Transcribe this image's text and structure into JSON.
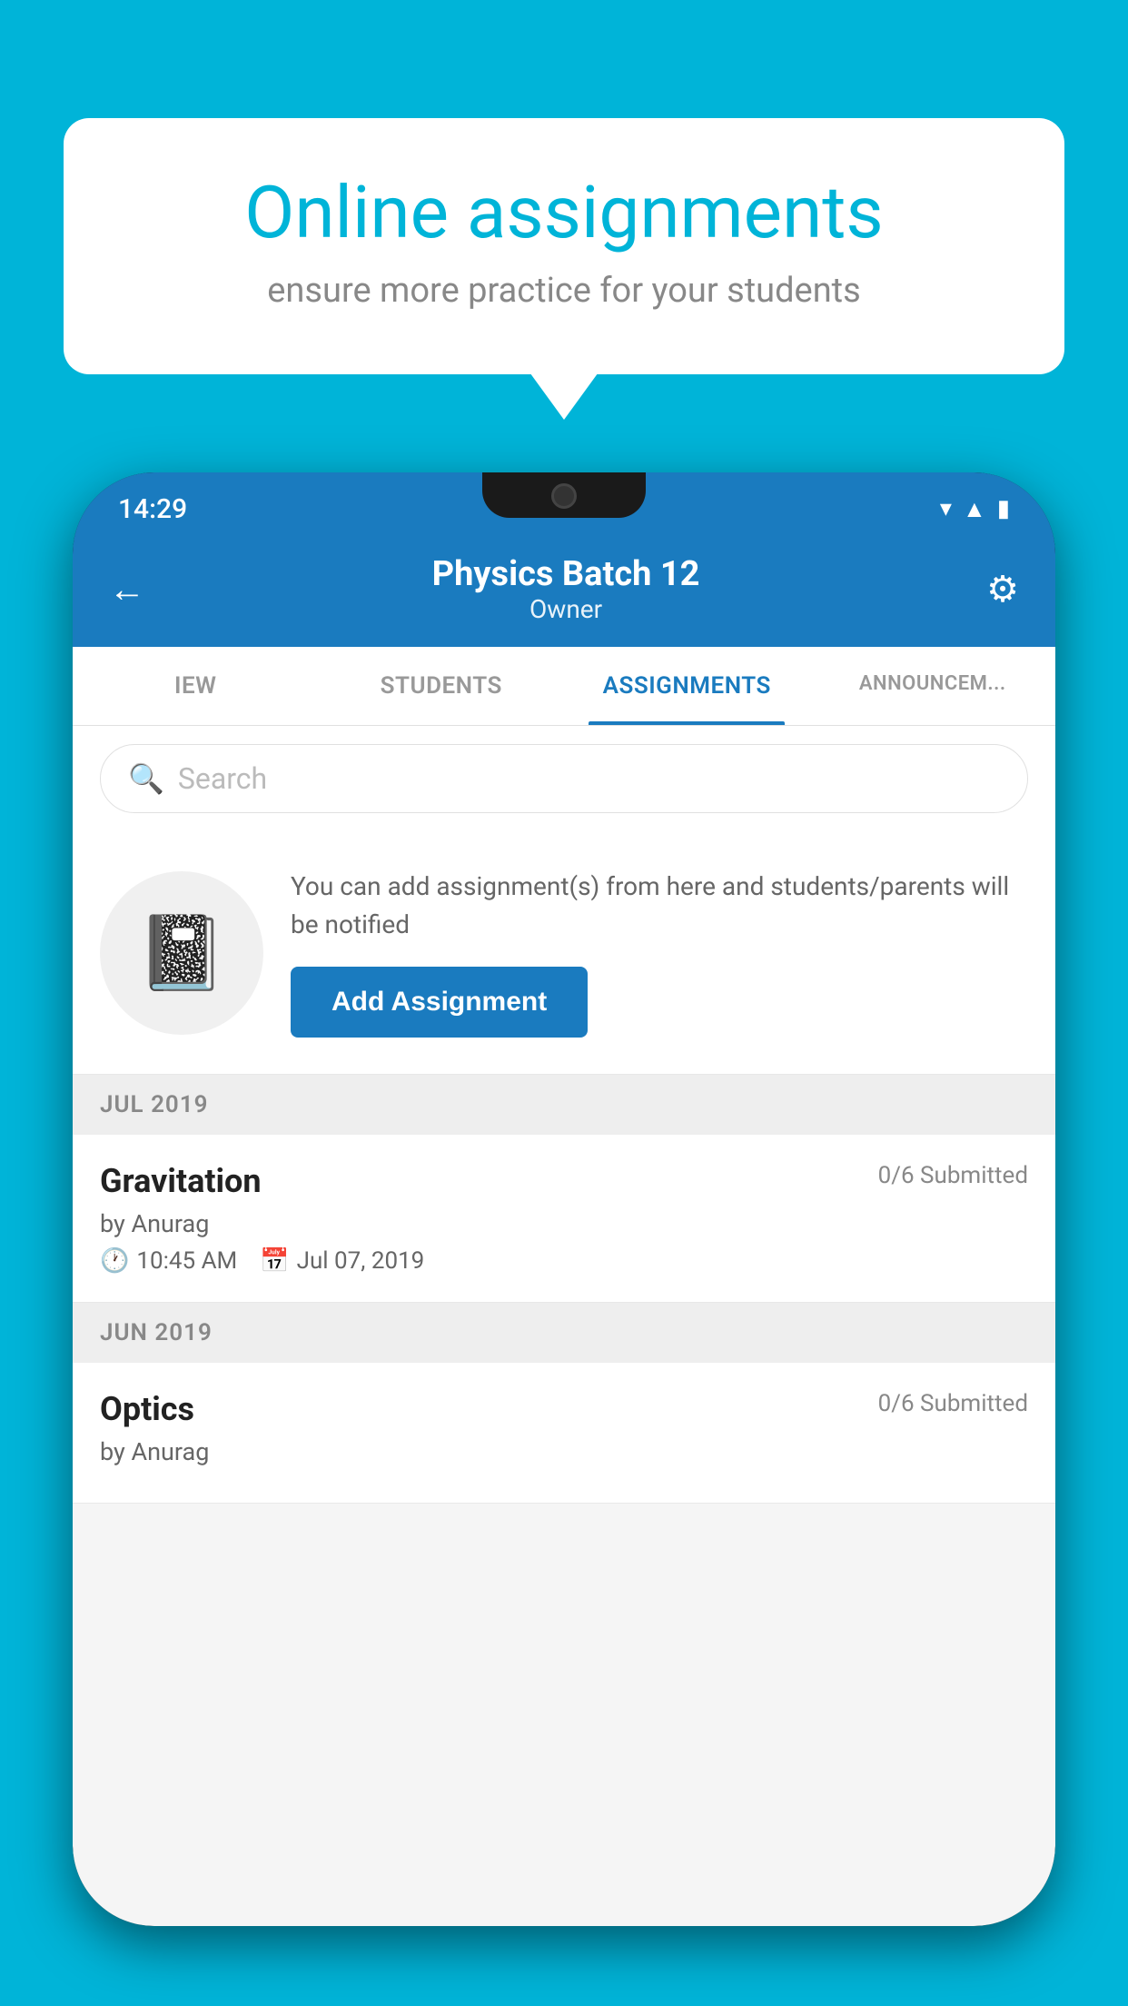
{
  "background_color": "#00b4d8",
  "speech_bubble": {
    "title": "Online assignments",
    "subtitle": "ensure more practice for your students"
  },
  "status_bar": {
    "time": "14:29",
    "icons": [
      "wifi",
      "signal",
      "battery"
    ]
  },
  "header": {
    "title": "Physics Batch 12",
    "subtitle": "Owner",
    "back_label": "←",
    "settings_label": "⚙"
  },
  "tabs": [
    {
      "label": "IEW",
      "active": false
    },
    {
      "label": "STUDENTS",
      "active": false
    },
    {
      "label": "ASSIGNMENTS",
      "active": true
    },
    {
      "label": "ANNOUNCEM...",
      "active": false
    }
  ],
  "search": {
    "placeholder": "Search"
  },
  "add_assignment_card": {
    "description": "You can add assignment(s) from here and students/parents will be notified",
    "button_label": "Add Assignment"
  },
  "sections": [
    {
      "label": "JUL 2019",
      "assignments": [
        {
          "name": "Gravitation",
          "submitted": "0/6 Submitted",
          "by": "by Anurag",
          "time": "10:45 AM",
          "date": "Jul 07, 2019"
        }
      ]
    },
    {
      "label": "JUN 2019",
      "assignments": [
        {
          "name": "Optics",
          "submitted": "0/6 Submitted",
          "by": "by Anurag",
          "time": "",
          "date": ""
        }
      ]
    }
  ]
}
